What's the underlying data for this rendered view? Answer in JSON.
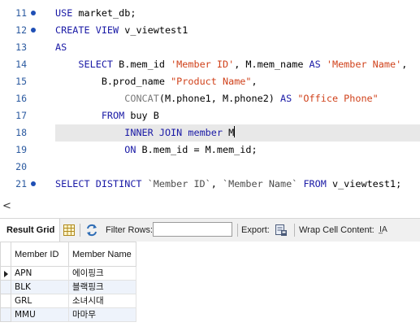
{
  "editor": {
    "lines": [
      {
        "num": "11",
        "dot": true,
        "tokens": [
          [
            "kw",
            "USE "
          ],
          [
            "id",
            "market_db;"
          ]
        ]
      },
      {
        "num": "12",
        "dot": true,
        "tokens": [
          [
            "kw",
            "CREATE VIEW "
          ],
          [
            "id",
            "v_viewtest1"
          ]
        ]
      },
      {
        "num": "13",
        "dot": false,
        "tokens": [
          [
            "kw",
            "AS"
          ]
        ]
      },
      {
        "num": "14",
        "dot": false,
        "tokens": [
          [
            "sp",
            "    "
          ],
          [
            "kw",
            "SELECT "
          ],
          [
            "id",
            "B.mem_id "
          ],
          [
            "str",
            "'Member ID'"
          ],
          [
            "id",
            ", M.mem_name "
          ],
          [
            "kw",
            "AS "
          ],
          [
            "str",
            "'Member Name'"
          ],
          [
            "id",
            ","
          ]
        ]
      },
      {
        "num": "15",
        "dot": false,
        "tokens": [
          [
            "sp",
            "        "
          ],
          [
            "id",
            "B.prod_name "
          ],
          [
            "str",
            "\"Product Name\""
          ],
          [
            "id",
            ","
          ]
        ]
      },
      {
        "num": "16",
        "dot": false,
        "tokens": [
          [
            "sp",
            "            "
          ],
          [
            "fn",
            "CONCAT"
          ],
          [
            "id",
            "(M.phone1, M.phone2) "
          ],
          [
            "kw",
            "AS "
          ],
          [
            "str",
            "\"Office Phone\""
          ]
        ]
      },
      {
        "num": "17",
        "dot": false,
        "tokens": [
          [
            "sp",
            "        "
          ],
          [
            "kw",
            "FROM "
          ],
          [
            "id",
            "buy B"
          ]
        ]
      },
      {
        "num": "18",
        "dot": false,
        "current": true,
        "tokens": [
          [
            "sp",
            "            "
          ],
          [
            "kw",
            "INNER JOIN "
          ],
          [
            "kw",
            "member "
          ],
          [
            "id",
            "M"
          ],
          [
            "caret",
            ""
          ]
        ]
      },
      {
        "num": "19",
        "dot": false,
        "tokens": [
          [
            "sp",
            "            "
          ],
          [
            "kw",
            "ON "
          ],
          [
            "id",
            "B.mem_id = M.mem_id;"
          ]
        ]
      },
      {
        "num": "20",
        "dot": false,
        "tokens": []
      },
      {
        "num": "21",
        "dot": true,
        "tokens": [
          [
            "kw",
            "SELECT DISTINCT "
          ],
          [
            "bt",
            "`Member ID`"
          ],
          [
            "id",
            ", "
          ],
          [
            "bt",
            "`Member Name`"
          ],
          [
            "id",
            " "
          ],
          [
            "kw",
            "FROM "
          ],
          [
            "id",
            "v_viewtest1;"
          ]
        ]
      }
    ]
  },
  "scroll": {
    "left_arrow": "<"
  },
  "toolbar": {
    "result_grid_label": "Result Grid",
    "filter_label": "Filter Rows:",
    "filter_value": "",
    "export_label": "Export:",
    "wrap_label": "Wrap Cell Content:",
    "wrap_icon_glyph": "I̲A"
  },
  "grid": {
    "columns": [
      "Member ID",
      "Member Name"
    ],
    "rows": [
      [
        "APN",
        "에이핑크"
      ],
      [
        "BLK",
        "블랙핑크"
      ],
      [
        "GRL",
        "소녀시대"
      ],
      [
        "MMU",
        "마마무"
      ]
    ]
  }
}
